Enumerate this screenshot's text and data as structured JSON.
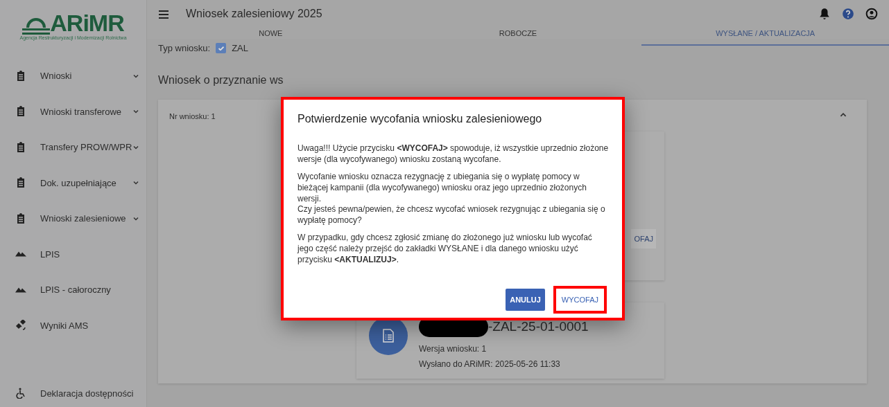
{
  "logo": {
    "name": "ARiMR",
    "subtitle": "Agencja Restrukturyzacji i Modernizacji Rolnictwa"
  },
  "sidebar": {
    "items": [
      {
        "label": "Wnioski",
        "kind": "group"
      },
      {
        "label": "Wnioski transferowe",
        "kind": "group"
      },
      {
        "label": "Transfery PROW/WPR",
        "kind": "group"
      },
      {
        "label": "Dok. uzupełniające",
        "kind": "group"
      },
      {
        "label": "Wnioski zalesieniowe",
        "kind": "group"
      },
      {
        "label": "LPIS",
        "kind": "map"
      },
      {
        "label": "LPIS - całoroczny",
        "kind": "map"
      },
      {
        "label": "Wyniki AMS",
        "kind": "satellite"
      }
    ],
    "footer_item": {
      "label": "Deklaracja dostępności",
      "kind": "accessibility"
    }
  },
  "header": {
    "title": "Wniosek zalesieniowy 2025"
  },
  "tabs": [
    {
      "label": "NOWE",
      "selected": false
    },
    {
      "label": "ROBOCZE",
      "selected": false
    },
    {
      "label": "WYSŁANE / AKTUALIZACJA",
      "selected": true
    }
  ],
  "filter": {
    "label": "Typ wniosku:",
    "option": "ZAL",
    "checked": true
  },
  "section_title": "Wniosek o przyznanie ws",
  "application_card": {
    "number": "Nr wniosku: 1",
    "expanded": true,
    "partial_button": "OFAJ",
    "version_card": {
      "id": "-ZAL-25-01-0001",
      "version": "Wersja wniosku: 1",
      "sent": "Wysłano do ARiMR: 2025-05-26 11:33"
    }
  },
  "dialog": {
    "title": "Potwierdzenie wycofania wniosku zalesieniowego",
    "paragraphs": [
      "Uwaga!!! Użycie przycisku **<WYCOFAJ>** spowoduje, iż wszystkie uprzednio złożone wersje (dla wycofywanego) wniosku zostaną wycofane.",
      "Wycofanie wniosku oznacza rezygnację z ubiegania się o wypłatę pomocy w bieżącej kampanii (dla wycofywanego) wniosku oraz jego uprzednio złożonych wersji.\nCzy jesteś pewna/pewien, że chcesz wycofać wniosek rezygnując z ubiegania się o wypłatę pomocy?",
      "W przypadku, gdy chcesz zgłosić zmianę do złożonego już wniosku lub wycofać jego część należy przejść do zakładki WYSŁANE i dla danego wniosku użyć przycisku **<AKTUALIZUJ>**."
    ],
    "buttons": [
      {
        "label": "ANULUJ",
        "kind": "primary",
        "highlighted": false
      },
      {
        "label": "WYCOFAJ",
        "kind": "text",
        "highlighted": true
      }
    ]
  }
}
